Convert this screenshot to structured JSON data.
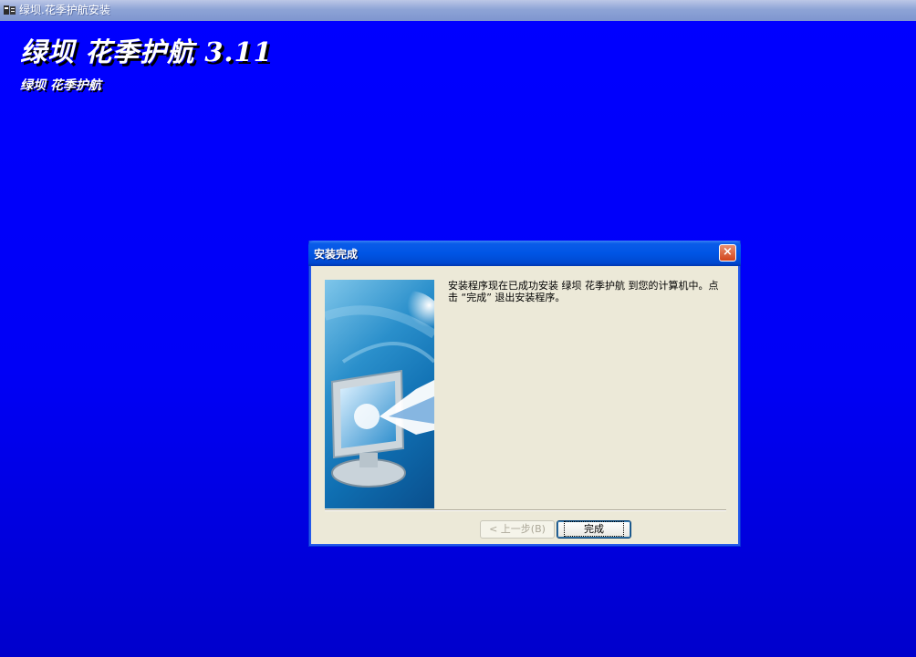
{
  "window": {
    "title": "绿坝.花季护航安装",
    "icon": "installer-app-icon"
  },
  "backdrop": {
    "title": "绿坝 花季护航 3.11",
    "subtitle": "绿坝 花季护航"
  },
  "dialog": {
    "title": "安装完成",
    "close_label": "×",
    "message": "安装程序现在已成功安装 绿坝 花季护航 到您的计算机中。点击 “完成” 退出安装程序。",
    "buttons": {
      "back": "< 上一步(B)",
      "finish": "完成"
    },
    "image": "computer-monitor-with-arrow-illustration"
  },
  "colors": {
    "backdrop": "#0000ff",
    "dialog_bg": "#ece9d8",
    "titlebar": "#0055e5"
  }
}
